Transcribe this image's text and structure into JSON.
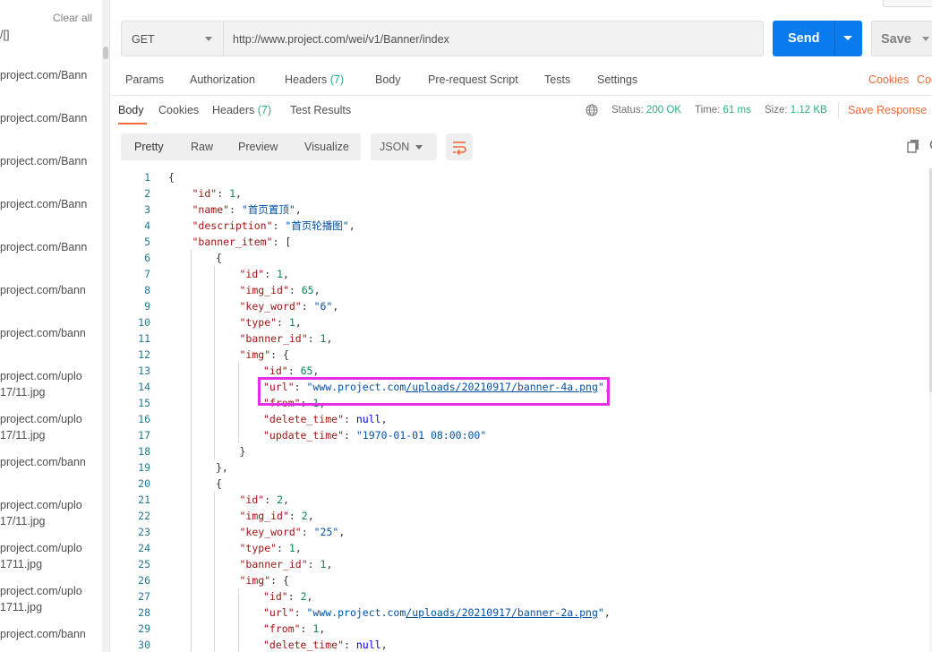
{
  "sidebar": {
    "clear_all": "Clear all",
    "items": [
      {
        "text": "/[]"
      },
      {
        "text": "project.com/Bann"
      },
      {
        "text": "project.com/Bann"
      },
      {
        "text": "project.com/Bann"
      },
      {
        "text": "project.com/Bann"
      },
      {
        "text": "project.com/Bann"
      },
      {
        "text": "project.com/bann"
      },
      {
        "text": "project.com/bann"
      },
      {
        "text": "project.com/uplo"
      },
      {
        "text": "17/11.jpg"
      },
      {
        "text": "project.com/uplo"
      },
      {
        "text": "17/11.jpg"
      },
      {
        "text": "project.com/bann"
      },
      {
        "text": "project.com/uplo"
      },
      {
        "text": "17/11.jpg"
      },
      {
        "text": "project.com/uplo"
      },
      {
        "text": "1711.jpg"
      },
      {
        "text": "project.com/uplo"
      },
      {
        "text": "1711.jpg"
      },
      {
        "text": "project.com/bann"
      }
    ]
  },
  "request": {
    "method": "GET",
    "url": "http://www.project.com/wei/v1/Banner/index",
    "send_label": "Send",
    "save_label": "Save"
  },
  "request_tabs": {
    "params": "Params",
    "authorization": "Authorization",
    "headers": "Headers",
    "headers_count": "(7)",
    "body": "Body",
    "pre_request": "Pre-request Script",
    "tests": "Tests",
    "settings": "Settings",
    "cookies": "Cookies",
    "code": "Code"
  },
  "response": {
    "tabs": {
      "body": "Body",
      "cookies": "Cookies",
      "headers": "Headers",
      "headers_count": "(7)",
      "test_results": "Test Results"
    },
    "status_label": "Status:",
    "status_value": "200 OK",
    "time_label": "Time:",
    "time_value": "61 ms",
    "size_label": "Size:",
    "size_value": "1.12 KB",
    "save_response": "Save Response"
  },
  "view": {
    "pretty": "Pretty",
    "raw": "Raw",
    "preview": "Preview",
    "visualize": "Visualize",
    "format": "JSON"
  },
  "colors": {
    "accent_orange": "#f26b3a",
    "send_blue": "#097bed",
    "status_green": "#26b47f",
    "highlight_magenta": "#e52ee5"
  },
  "code_lines": [
    {
      "n": "1",
      "indent": 0,
      "t": [
        [
          "p",
          "{"
        ]
      ]
    },
    {
      "n": "2",
      "indent": 1,
      "t": [
        [
          "k",
          "\"id\""
        ],
        [
          "p",
          ": "
        ],
        [
          "n",
          "1"
        ],
        [
          "p",
          ","
        ]
      ]
    },
    {
      "n": "3",
      "indent": 1,
      "t": [
        [
          "k",
          "\"name\""
        ],
        [
          "p",
          ": "
        ],
        [
          "s",
          "\"首页置顶\""
        ],
        [
          "p",
          ","
        ]
      ]
    },
    {
      "n": "4",
      "indent": 1,
      "t": [
        [
          "k",
          "\"description\""
        ],
        [
          "p",
          ": "
        ],
        [
          "s",
          "\"首页轮播图\""
        ],
        [
          "p",
          ","
        ]
      ]
    },
    {
      "n": "5",
      "indent": 1,
      "t": [
        [
          "k",
          "\"banner_item\""
        ],
        [
          "p",
          ": ["
        ]
      ]
    },
    {
      "n": "6",
      "indent": 2,
      "t": [
        [
          "p",
          "{"
        ]
      ]
    },
    {
      "n": "7",
      "indent": 3,
      "t": [
        [
          "k",
          "\"id\""
        ],
        [
          "p",
          ": "
        ],
        [
          "n",
          "1"
        ],
        [
          "p",
          ","
        ]
      ]
    },
    {
      "n": "8",
      "indent": 3,
      "t": [
        [
          "k",
          "\"img_id\""
        ],
        [
          "p",
          ": "
        ],
        [
          "n",
          "65"
        ],
        [
          "p",
          ","
        ]
      ]
    },
    {
      "n": "9",
      "indent": 3,
      "t": [
        [
          "k",
          "\"key_word\""
        ],
        [
          "p",
          ": "
        ],
        [
          "s",
          "\"6\""
        ],
        [
          "p",
          ","
        ]
      ]
    },
    {
      "n": "10",
      "indent": 3,
      "t": [
        [
          "k",
          "\"type\""
        ],
        [
          "p",
          ": "
        ],
        [
          "n",
          "1"
        ],
        [
          "p",
          ","
        ]
      ]
    },
    {
      "n": "11",
      "indent": 3,
      "t": [
        [
          "k",
          "\"banner_id\""
        ],
        [
          "p",
          ": "
        ],
        [
          "n",
          "1"
        ],
        [
          "p",
          ","
        ]
      ]
    },
    {
      "n": "12",
      "indent": 3,
      "t": [
        [
          "k",
          "\"img\""
        ],
        [
          "p",
          ": {"
        ]
      ]
    },
    {
      "n": "13",
      "indent": 4,
      "t": [
        [
          "k",
          "\"id\""
        ],
        [
          "p",
          ": "
        ],
        [
          "n",
          "65"
        ],
        [
          "p",
          ","
        ]
      ]
    },
    {
      "n": "14",
      "indent": 4,
      "t": [
        [
          "k",
          "\"url\""
        ],
        [
          "p",
          ": "
        ],
        [
          "s",
          "\"www.project.com"
        ],
        [
          "su",
          "/uploads/20210917/banner-4a.png"
        ],
        [
          "s",
          "\""
        ],
        [
          "p",
          ","
        ]
      ]
    },
    {
      "n": "15",
      "indent": 4,
      "t": [
        [
          "k",
          "\"from\""
        ],
        [
          "p",
          ": "
        ],
        [
          "n",
          "1"
        ],
        [
          "p",
          ","
        ]
      ]
    },
    {
      "n": "16",
      "indent": 4,
      "t": [
        [
          "k",
          "\"delete_time\""
        ],
        [
          "p",
          ": "
        ],
        [
          "nl",
          "null"
        ],
        [
          "p",
          ","
        ]
      ]
    },
    {
      "n": "17",
      "indent": 4,
      "t": [
        [
          "k",
          "\"update_time\""
        ],
        [
          "p",
          ": "
        ],
        [
          "s",
          "\"1970-01-01 08:00:00\""
        ]
      ]
    },
    {
      "n": "18",
      "indent": 3,
      "t": [
        [
          "p",
          "}"
        ]
      ]
    },
    {
      "n": "19",
      "indent": 2,
      "t": [
        [
          "p",
          "},"
        ]
      ]
    },
    {
      "n": "20",
      "indent": 2,
      "t": [
        [
          "p",
          "{"
        ]
      ]
    },
    {
      "n": "21",
      "indent": 3,
      "t": [
        [
          "k",
          "\"id\""
        ],
        [
          "p",
          ": "
        ],
        [
          "n",
          "2"
        ],
        [
          "p",
          ","
        ]
      ]
    },
    {
      "n": "22",
      "indent": 3,
      "t": [
        [
          "k",
          "\"img_id\""
        ],
        [
          "p",
          ": "
        ],
        [
          "n",
          "2"
        ],
        [
          "p",
          ","
        ]
      ]
    },
    {
      "n": "23",
      "indent": 3,
      "t": [
        [
          "k",
          "\"key_word\""
        ],
        [
          "p",
          ": "
        ],
        [
          "s",
          "\"25\""
        ],
        [
          "p",
          ","
        ]
      ]
    },
    {
      "n": "24",
      "indent": 3,
      "t": [
        [
          "k",
          "\"type\""
        ],
        [
          "p",
          ": "
        ],
        [
          "n",
          "1"
        ],
        [
          "p",
          ","
        ]
      ]
    },
    {
      "n": "25",
      "indent": 3,
      "t": [
        [
          "k",
          "\"banner_id\""
        ],
        [
          "p",
          ": "
        ],
        [
          "n",
          "1"
        ],
        [
          "p",
          ","
        ]
      ]
    },
    {
      "n": "26",
      "indent": 3,
      "t": [
        [
          "k",
          "\"img\""
        ],
        [
          "p",
          ": {"
        ]
      ]
    },
    {
      "n": "27",
      "indent": 4,
      "t": [
        [
          "k",
          "\"id\""
        ],
        [
          "p",
          ": "
        ],
        [
          "n",
          "2"
        ],
        [
          "p",
          ","
        ]
      ]
    },
    {
      "n": "28",
      "indent": 4,
      "t": [
        [
          "k",
          "\"url\""
        ],
        [
          "p",
          ": "
        ],
        [
          "s",
          "\"www.project.com"
        ],
        [
          "su",
          "/uploads/20210917/banner-2a.png"
        ],
        [
          "s",
          "\""
        ],
        [
          "p",
          ","
        ]
      ]
    },
    {
      "n": "29",
      "indent": 4,
      "t": [
        [
          "k",
          "\"from\""
        ],
        [
          "p",
          ": "
        ],
        [
          "n",
          "1"
        ],
        [
          "p",
          ","
        ]
      ]
    },
    {
      "n": "30",
      "indent": 4,
      "t": [
        [
          "k",
          "\"delete_time\""
        ],
        [
          "p",
          ": "
        ],
        [
          "nl",
          "null"
        ],
        [
          "p",
          ","
        ]
      ]
    }
  ]
}
